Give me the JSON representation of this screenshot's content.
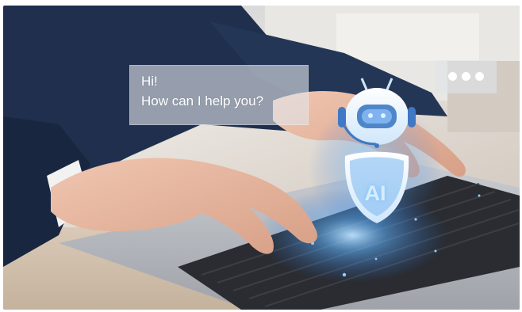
{
  "chat": {
    "line1": "Hi!",
    "line2": "How can I help you?"
  },
  "robot": {
    "badge_text": "AI"
  },
  "colors": {
    "suit": "#1f2f4d",
    "laptop": "#b9bcc1",
    "keys": "#2a2c31",
    "glow": "#4aa8ff",
    "skin": "#e7b7a0"
  }
}
